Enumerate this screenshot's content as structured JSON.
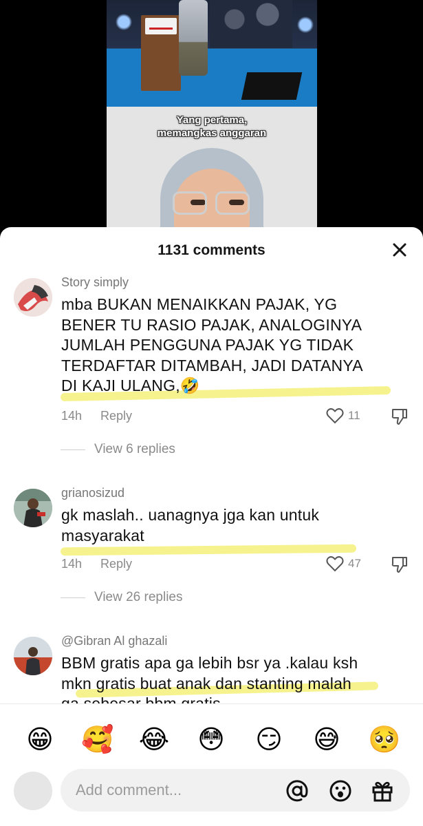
{
  "video": {
    "caption_line1": "Yang pertama,",
    "caption_line2": "memangkas anggaran"
  },
  "sheet": {
    "title": "1131 comments",
    "close_icon": "close-icon"
  },
  "comments": [
    {
      "username": "Story simply",
      "lines": [
        "mba BUKAN MENAIKKAN PAJAK, YG",
        "BENER TU RASIO PAJAK, ANALOGINYA",
        "JUMLAH PENGGUNA PAJAK YG TIDAK",
        "TERDAFTAR DITAMBAH, JADI DATANYA",
        "DI KAJI ULANG,🤣"
      ],
      "time": "14h",
      "reply_label": "Reply",
      "likes": "11",
      "view_replies": "View 6 replies"
    },
    {
      "username": "grianosizud",
      "lines": [
        "gk maslah.. uanagnya jga kan untuk",
        "masyarakat"
      ],
      "time": "14h",
      "reply_label": "Reply",
      "likes": "47",
      "view_replies": "View 26 replies"
    },
    {
      "username": "@Gibran Al ghazali",
      "lines": [
        "BBM gratis apa ga lebih bsr ya .kalau ksh",
        "mkn gratis buat anak dan stanting malah",
        "ga sebesar bbm gratis"
      ]
    }
  ],
  "emojis": [
    "😁",
    "🥰",
    "😂",
    "😳",
    "😏",
    "😅",
    "🥺"
  ],
  "input": {
    "placeholder": "Add comment...",
    "icons": [
      "at-icon",
      "emoji-icon",
      "gift-icon"
    ]
  },
  "colors": {
    "highlight": "#f3ef6a",
    "muted": "#8a8a8a",
    "text": "#111111"
  }
}
